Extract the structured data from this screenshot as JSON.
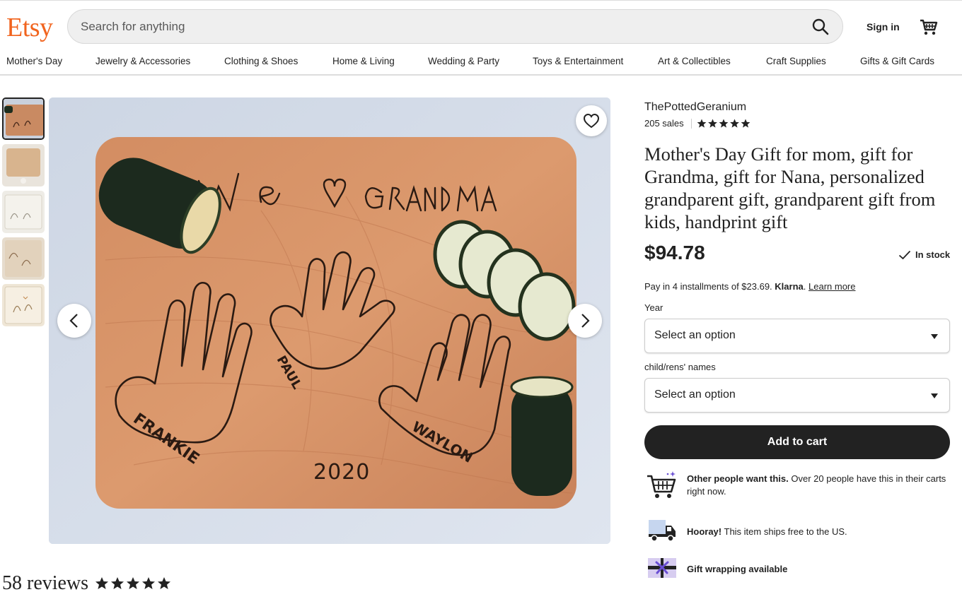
{
  "header": {
    "logo": "Etsy",
    "search_placeholder": "Search for anything",
    "sign_in": "Sign in",
    "brand_color": "#f1641e"
  },
  "nav": {
    "items": [
      "Mother's Day",
      "Jewelry & Accessories",
      "Clothing & Shoes",
      "Home & Living",
      "Wedding & Party",
      "Toys & Entertainment",
      "Art & Collectibles",
      "Craft Supplies",
      "Gifts & Gift Cards"
    ]
  },
  "gallery": {
    "thumbnail_count": 5,
    "active_index": 0,
    "board_text": {
      "heading": "We ♡ Grandma",
      "names": [
        "FRANKIE",
        "PAUL",
        "WAYLON"
      ],
      "year": "2020"
    }
  },
  "reviews": {
    "count_label": "58 reviews",
    "rating": 5
  },
  "listing": {
    "shop_name": "ThePottedGeranium",
    "sales": "205 sales",
    "shop_rating": 5,
    "title": "Mother's Day Gift for mom, gift for Grandma, gift for Nana, personalized grandparent gift, grandparent gift from kids, handprint gift",
    "price": "$94.78",
    "stock_status": "In stock",
    "klarna": {
      "prefix": "Pay in 4 installments of $23.69.",
      "brand": "Klarna",
      "link": "Learn more"
    },
    "options": [
      {
        "label": "Year",
        "value": "Select an option"
      },
      {
        "label": "child/rens' names",
        "value": "Select an option"
      }
    ],
    "add_to_cart": "Add to cart",
    "perks": [
      {
        "icon": "cart-sparkle-icon",
        "bold": "Other people want this.",
        "text": " Over 20 people have this in their carts right now."
      },
      {
        "icon": "delivery-truck-icon",
        "bold": "Hooray!",
        "text": " This item ships free to the US."
      },
      {
        "icon": "gift-icon",
        "bold": "Gift wrapping available",
        "text": ""
      }
    ]
  }
}
